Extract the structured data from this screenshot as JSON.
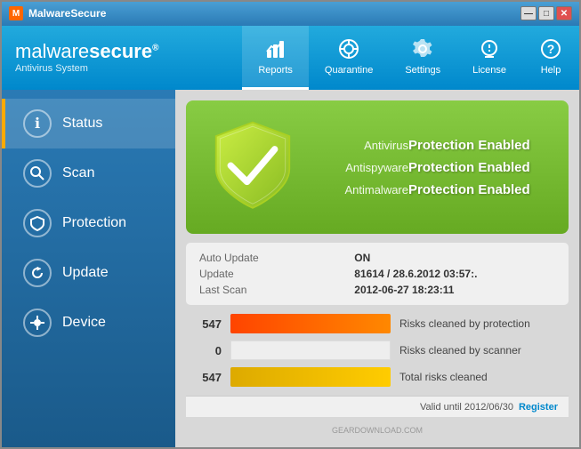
{
  "window": {
    "title": "MalwareSecure",
    "controls": {
      "minimize": "—",
      "maximize": "□",
      "close": "✕"
    }
  },
  "brand": {
    "name_light": "malware",
    "name_bold": "secure",
    "superscript": "®",
    "subtitle": "Antivirus System"
  },
  "nav": {
    "tabs": [
      {
        "id": "reports",
        "label": "Reports",
        "icon": "📊",
        "active": true
      },
      {
        "id": "quarantine",
        "label": "Quarantine",
        "icon": "☢"
      },
      {
        "id": "settings",
        "label": "Settings",
        "icon": "⚙"
      },
      {
        "id": "license",
        "label": "License",
        "icon": "🔍"
      },
      {
        "id": "help",
        "label": "Help",
        "icon": "?"
      }
    ]
  },
  "sidebar": {
    "items": [
      {
        "id": "status",
        "label": "Status",
        "icon": "ℹ",
        "active": true
      },
      {
        "id": "scan",
        "label": "Scan",
        "icon": "🔍"
      },
      {
        "id": "protection",
        "label": "Protection",
        "icon": "🛡"
      },
      {
        "id": "update",
        "label": "Update",
        "icon": "🔄"
      },
      {
        "id": "device",
        "label": "Device",
        "icon": "🔌"
      }
    ]
  },
  "status_panel": {
    "protection_rows": [
      {
        "label": "Antivirus",
        "status": "Protection Enabled"
      },
      {
        "label": "Antispyware",
        "status": "Protection Enabled"
      },
      {
        "label": "Antimalware",
        "status": "Protection Enabled"
      }
    ]
  },
  "info_panel": {
    "rows": [
      {
        "key": "Auto Update",
        "value": "ON"
      },
      {
        "key": "Update",
        "value": "81614 / 28.6.2012 03:57:."
      },
      {
        "key": "Last Scan",
        "value": "2012-06-27 18:23:11"
      }
    ]
  },
  "stats": [
    {
      "id": "risks-protection",
      "number": "547",
      "bar_type": "red",
      "label": "Risks cleaned by protection",
      "bar_pct": 100
    },
    {
      "id": "risks-scanner",
      "number": "0",
      "bar_type": "orange",
      "label": "Risks cleaned by scanner",
      "bar_pct": 0
    },
    {
      "id": "risks-total",
      "number": "547",
      "bar_type": "yellow",
      "label": "Total risks cleaned",
      "bar_pct": 100
    }
  ],
  "footer": {
    "valid_text": "Valid until 2012/06/30",
    "register_label": "Register"
  },
  "watermark": "GEARDOWNLOAD.COM"
}
